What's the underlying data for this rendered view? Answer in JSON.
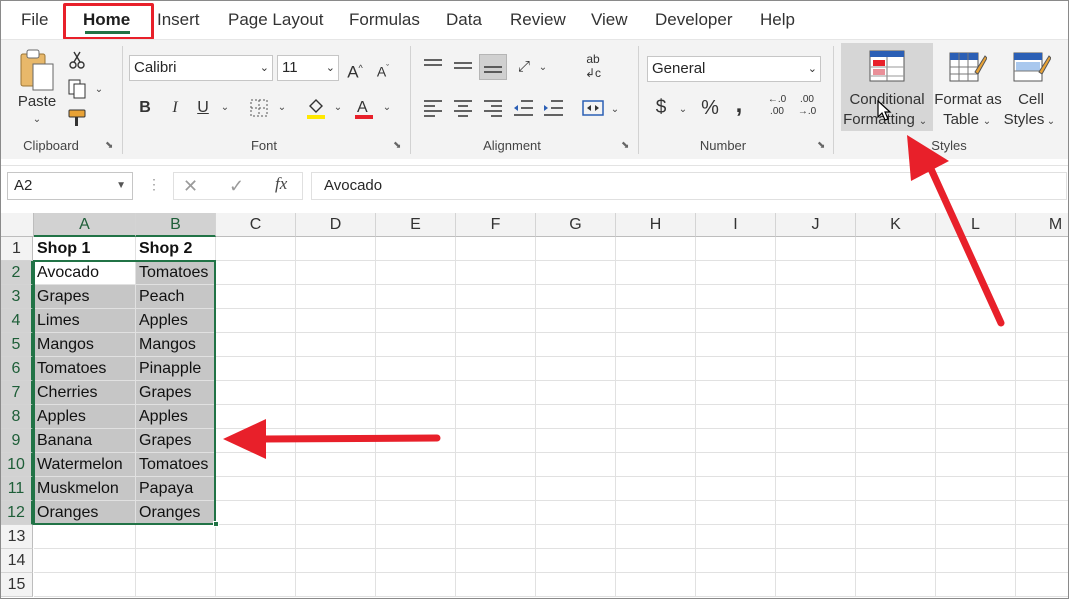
{
  "tabs": [
    "File",
    "Home",
    "Insert",
    "Page Layout",
    "Formulas",
    "Data",
    "Review",
    "View",
    "Developer",
    "Help"
  ],
  "clipboard": {
    "paste": "Paste",
    "group": "Clipboard"
  },
  "font": {
    "name": "Calibri",
    "size": "11",
    "group": "Font"
  },
  "alignment": {
    "group": "Alignment"
  },
  "number": {
    "format": "General",
    "currency": "$",
    "percent": "%",
    "comma": ",",
    "group": "Number"
  },
  "styles": {
    "cf_line1": "Conditional",
    "cf_line2": "Formatting",
    "fat_line1": "Format as",
    "fat_line2": "Table",
    "cs_line1": "Cell",
    "cs_line2": "Styles",
    "group": "Styles"
  },
  "formula_bar": {
    "name_box": "A2",
    "fx": "fx",
    "content": "Avocado"
  },
  "columns": [
    "A",
    "B",
    "C",
    "D",
    "E",
    "F",
    "G",
    "H",
    "I",
    "J",
    "K",
    "L",
    "M"
  ],
  "rows": [
    "1",
    "2",
    "3",
    "4",
    "5",
    "6",
    "7",
    "8",
    "9",
    "10",
    "11",
    "12",
    "13",
    "14",
    "15"
  ],
  "cells": [
    [
      "Shop 1",
      "Shop 2"
    ],
    [
      "Avocado",
      "Tomatoes"
    ],
    [
      "Grapes",
      "Peach"
    ],
    [
      "Limes",
      "Apples"
    ],
    [
      "Mangos",
      "Mangos"
    ],
    [
      "Tomatoes",
      "Pinapple"
    ],
    [
      "Cherries",
      "Grapes"
    ],
    [
      "Apples",
      "Apples"
    ],
    [
      "Banana",
      "Grapes"
    ],
    [
      "Watermelon",
      "Tomatoes"
    ],
    [
      "Muskmelon",
      "Papaya"
    ],
    [
      "Oranges",
      "Oranges"
    ]
  ],
  "colors": {
    "selection": "#217346",
    "annotation": "#e8202a",
    "highlight": "#c6c6c6",
    "accent_green": "#217346"
  },
  "icons": [
    "scissors-icon",
    "copy-icon",
    "format-painter-icon",
    "bold-icon",
    "italic-icon",
    "underline-icon",
    "borders-icon",
    "fill-color-icon",
    "font-color-icon",
    "conditional-formatting-icon",
    "format-as-table-icon",
    "cell-styles-icon",
    "cursor-icon"
  ]
}
